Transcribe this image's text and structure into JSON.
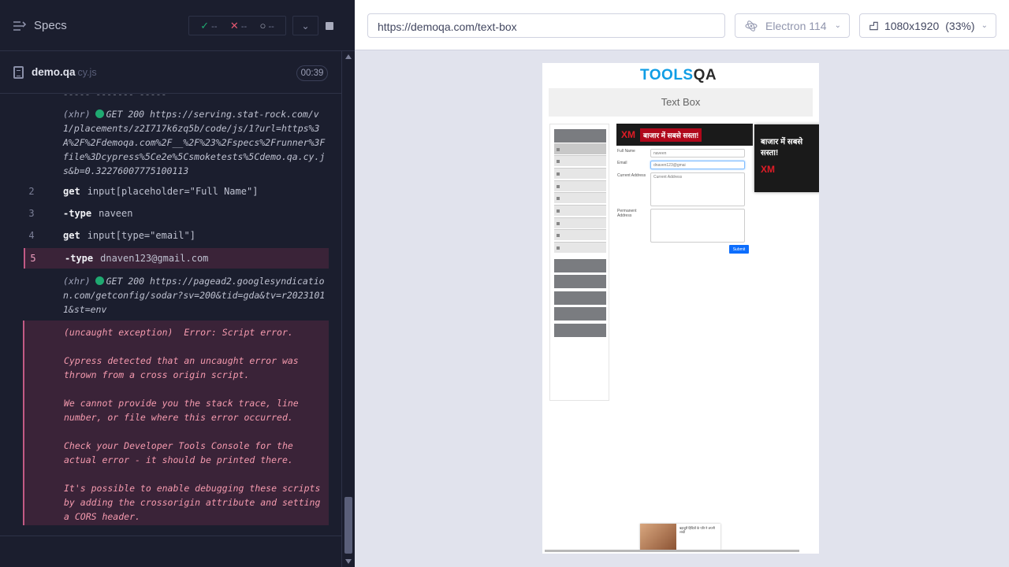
{
  "reporter": {
    "specs_label": "Specs",
    "stats": {
      "passed": "--",
      "failed": "--",
      "pending": "--"
    },
    "spec": {
      "name": "demo.qa",
      "ext": "cy.js",
      "duration": "00:39"
    },
    "cut_line": "----- ------- -----",
    "xhr1": {
      "tag": "(xhr)",
      "method": "GET 200",
      "url": "https://serving.stat-rock.com/v1/placements/z2I717k6zq5b/code/js/1?url=https%3A%2F%2Fdemoqa.com%2F__%2F%23%2Fspecs%2Frunner%3Ffile%3Dcypress%5Ce2e%5Csmoketests%5Cdemo.qa.cy.js&b=0.32276007775100113"
    },
    "commands": [
      {
        "num": "2",
        "name": "get",
        "arg": "input[placeholder=\"Full Name\"]"
      },
      {
        "num": "3",
        "name": "-type",
        "arg": "naveen"
      },
      {
        "num": "4",
        "name": "get",
        "arg": "input[type=\"email\"]"
      },
      {
        "num": "5",
        "name": "-type",
        "arg": "dnaven123@gmail.com"
      }
    ],
    "xhr2": {
      "tag": "(xhr)",
      "method": "GET 200",
      "url": "https://pagead2.googlesyndication.com/getconfig/sodar?sv=200&tid=gda&tv=r20231011&st=env"
    },
    "error": "(uncaught exception)  Error: Script error.\n\nCypress detected that an uncaught error was thrown from a cross origin script.\n\nWe cannot provide you the stack trace, line number, or file where this error occurred.\n\nCheck your Developer Tools Console for the actual error - it should be printed there.\n\nIt's possible to enable debugging these scripts by adding the crossorigin attribute and setting a CORS header."
  },
  "aut": {
    "url": "https://demoqa.com/text-box",
    "browser": "Electron 114",
    "viewport": "1080x1920",
    "scale": "(33%)"
  },
  "page": {
    "logo_a": "TOOLS",
    "logo_b": "QA",
    "title": "Text Box",
    "ad_top_text": "बाजार में सबसे सस्ता!",
    "ad_top_brand": "XM",
    "ad_side_text": "बाजार में सबसे सस्ता!",
    "ad_side_brand": "XM",
    "form": {
      "full_name_label": "Full Name",
      "full_name_value": "naveen",
      "email_label": "Email",
      "email_value": "dnaven123@gmai",
      "current_address_label": "Current Address",
      "current_address_placeholder": "Current Address",
      "permanent_address_label": "Permanent Address",
      "submit": "Submit"
    },
    "ad_bottom_text": "बहादुरी हिंदियों के पति ने अपनी शादी"
  },
  "colors": {
    "accent_error": "#f59aae",
    "pass": "#1fa971",
    "fail": "#e45770",
    "link": "#0d6efd"
  }
}
